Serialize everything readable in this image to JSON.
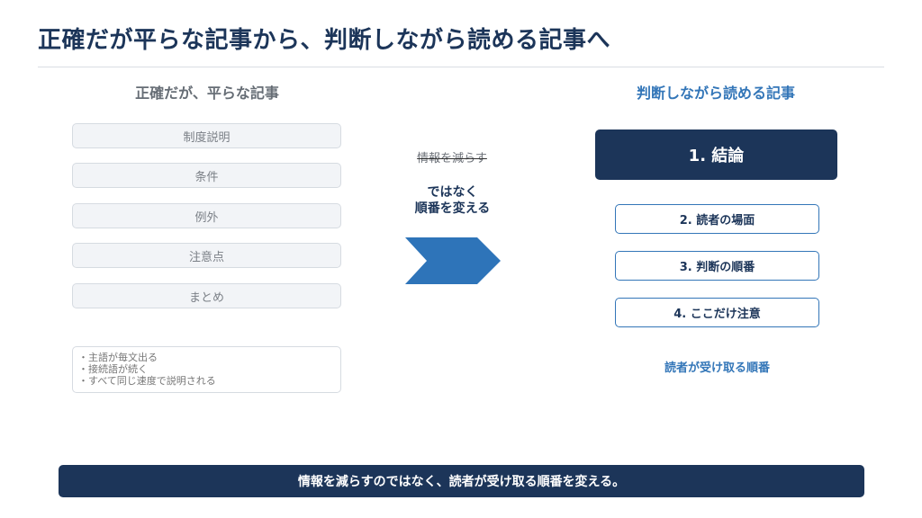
{
  "title": "正確だが平らな記事から、判断しながら読める記事へ",
  "left": {
    "heading": "正確だが、平らな記事",
    "items": [
      "制度説明",
      "条件",
      "例外",
      "注意点",
      "まとめ"
    ],
    "notes": [
      "・主語が毎文出る",
      "・接続語が続く",
      "・すべて同じ速度で説明される"
    ]
  },
  "middle": {
    "struck": "情報を減らす",
    "line1": "ではなく",
    "line2": "順番を変える"
  },
  "right": {
    "heading": "判断しながら読める記事",
    "steps": [
      "1. 結論",
      "2. 読者の場面",
      "3. 判断の順番",
      "4. ここだけ注意"
    ],
    "caption": "読者が受け取る順番"
  },
  "banner": "情報を減らすのではなく、読者が受け取る順番を変える。",
  "colors": {
    "navy": "#1c3559",
    "blue": "#3376b8",
    "arrow": "#2e74b9"
  }
}
